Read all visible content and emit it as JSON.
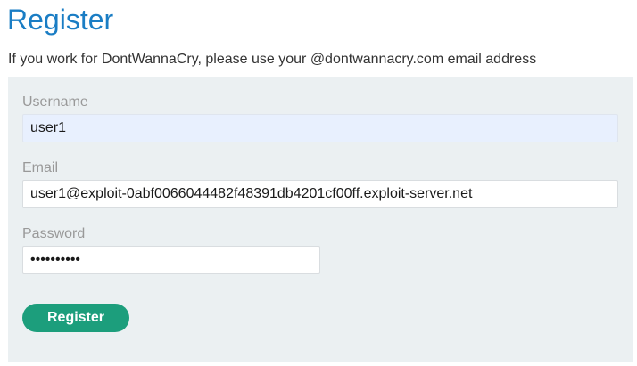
{
  "page": {
    "title": "Register",
    "intro": "If you work for DontWannaCry, please use your @dontwannacry.com email address"
  },
  "form": {
    "username": {
      "label": "Username",
      "value": "user1"
    },
    "email": {
      "label": "Email",
      "value": "user1@exploit-0abf0066044482f48391db4201cf00ff.exploit-server.net"
    },
    "password": {
      "label": "Password",
      "value": "••••••••••"
    },
    "submit_label": "Register"
  },
  "colors": {
    "title": "#1a7dc4",
    "form_background": "#ebf0f2",
    "button": "#1c9e7c",
    "autofill": "#e8f0fe"
  }
}
